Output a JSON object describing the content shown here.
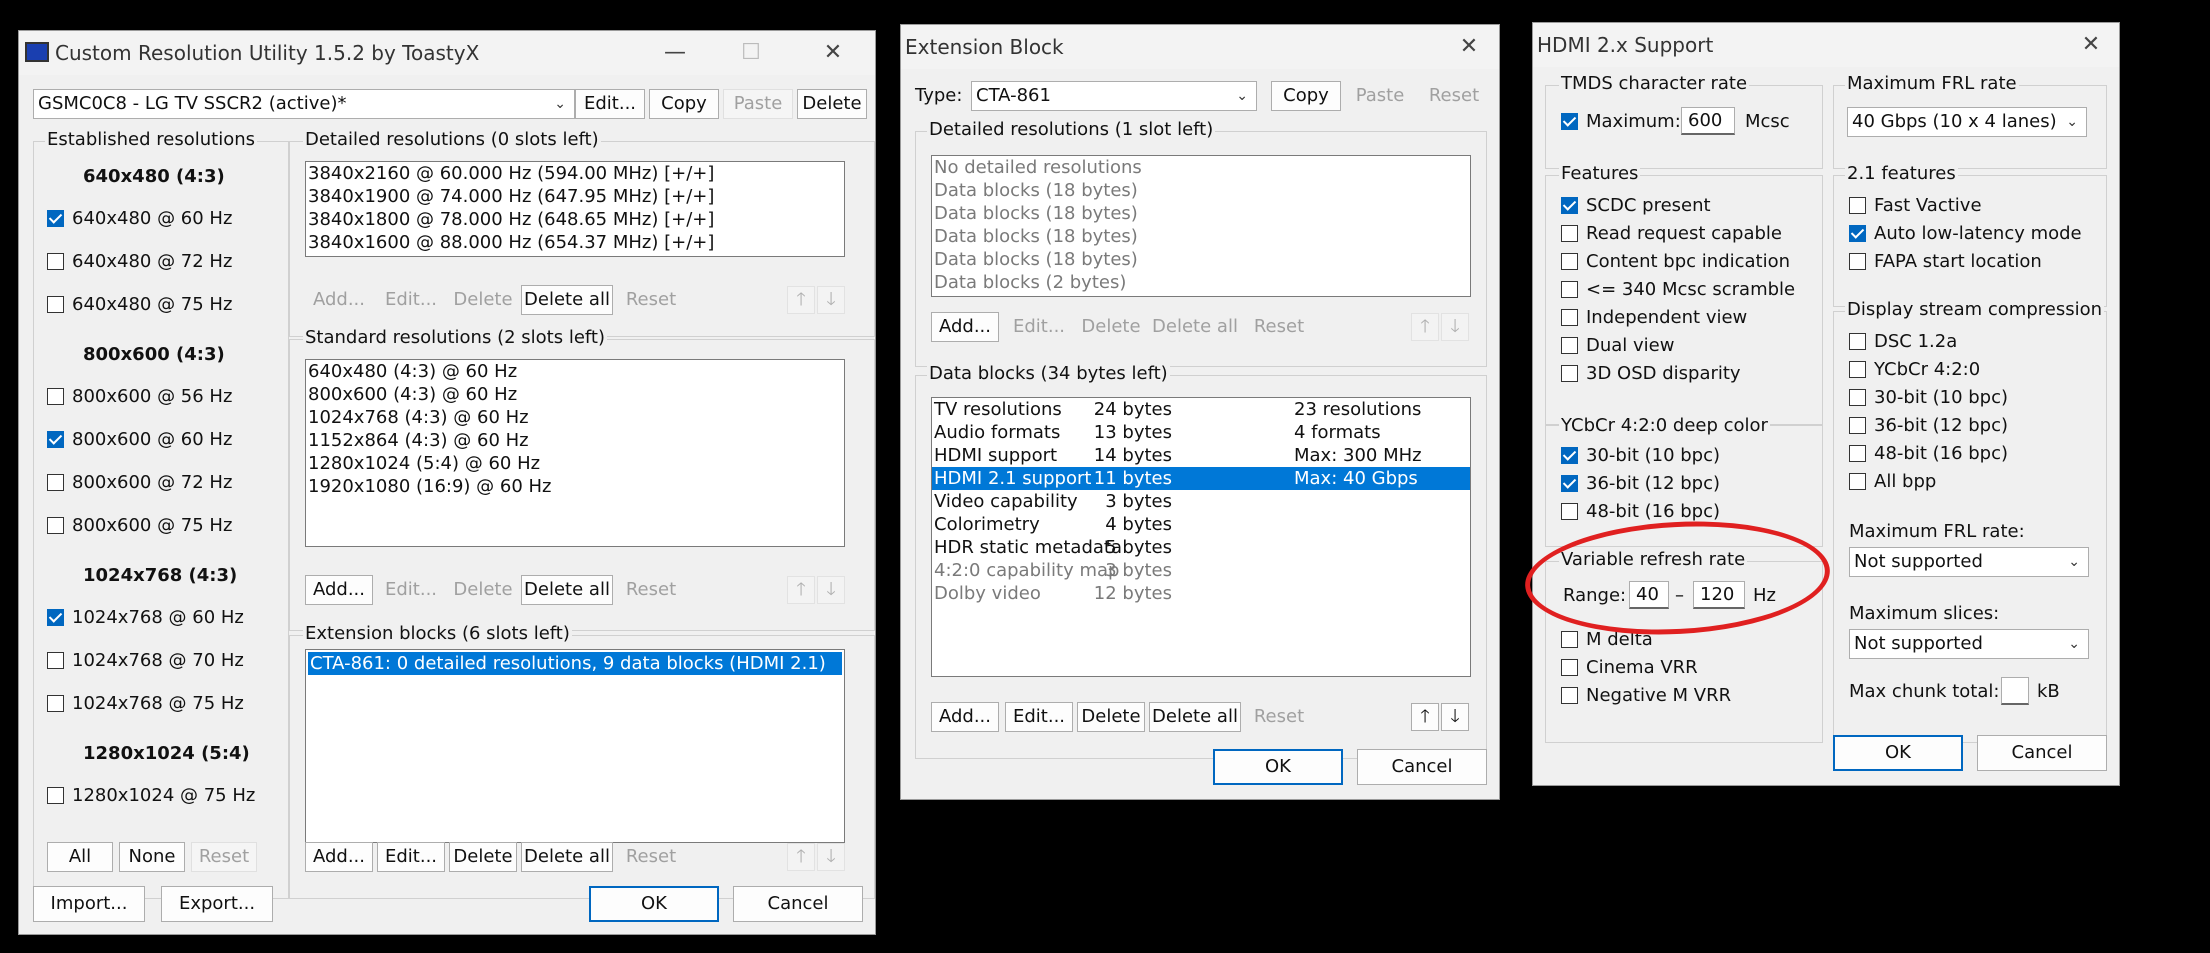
{
  "cru": {
    "title": "Custom Resolution Utility 1.5.2 by ToastyX",
    "monitor": "GSMC0C8 - LG TV SSCR2 (active)*",
    "top_buttons": [
      "Edit...",
      "Copy",
      "Paste",
      "Delete"
    ],
    "established": {
      "label": "Established resolutions",
      "groups": [
        {
          "head": "640x480 (4:3)",
          "items": [
            {
              "label": "640x480 @ 60 Hz",
              "checked": true
            },
            {
              "label": "640x480 @ 72 Hz",
              "checked": false
            },
            {
              "label": "640x480 @ 75 Hz",
              "checked": false
            }
          ]
        },
        {
          "head": "800x600 (4:3)",
          "items": [
            {
              "label": "800x600 @ 56 Hz",
              "checked": false
            },
            {
              "label": "800x600 @ 60 Hz",
              "checked": true
            },
            {
              "label": "800x600 @ 72 Hz",
              "checked": false
            },
            {
              "label": "800x600 @ 75 Hz",
              "checked": false
            }
          ]
        },
        {
          "head": "1024x768 (4:3)",
          "items": [
            {
              "label": "1024x768 @ 60 Hz",
              "checked": true
            },
            {
              "label": "1024x768 @ 70 Hz",
              "checked": false
            },
            {
              "label": "1024x768 @ 75 Hz",
              "checked": false
            }
          ]
        },
        {
          "head": "1280x1024 (5:4)",
          "items": [
            {
              "label": "1280x1024 @ 75 Hz",
              "checked": false
            }
          ]
        }
      ],
      "buttons": [
        "All",
        "None",
        "Reset"
      ]
    },
    "detailed": {
      "label": "Detailed resolutions (0 slots left)",
      "items": [
        "3840x2160 @ 60.000 Hz (594.00 MHz) [+/+]",
        "3840x1900 @ 74.000 Hz (647.95 MHz) [+/+]",
        "3840x1800 @ 78.000 Hz (648.65 MHz) [+/+]",
        "3840x1600 @ 88.000 Hz (654.37 MHz) [+/+]"
      ]
    },
    "standard": {
      "label": "Standard resolutions (2 slots left)",
      "items": [
        "640x480 (4:3) @ 60 Hz",
        "800x600 (4:3) @ 60 Hz",
        "1024x768 (4:3) @ 60 Hz",
        "1152x864 (4:3) @ 60 Hz",
        "1280x1024 (5:4) @ 60 Hz",
        "1920x1080 (16:9) @ 60 Hz"
      ]
    },
    "extension": {
      "label": "Extension blocks (6 slots left)",
      "items": [
        "CTA-861: 0 detailed resolutions, 9 data blocks (HDMI 2.1)"
      ]
    },
    "list_buttons": [
      "Add...",
      "Edit...",
      "Delete",
      "Delete all",
      "Reset"
    ],
    "import": "Import...",
    "export": "Export...",
    "ok": "OK",
    "cancel": "Cancel"
  },
  "ext": {
    "title": "Extension Block",
    "type_label": "Type:",
    "type_value": "CTA-861",
    "top_buttons": [
      "Copy",
      "Paste",
      "Reset"
    ],
    "detailed": {
      "label": "Detailed resolutions (1 slot left)",
      "items": [
        "No detailed resolutions",
        "Data blocks (18 bytes)",
        "Data blocks (18 bytes)",
        "Data blocks (18 bytes)",
        "Data blocks (18 bytes)",
        "Data blocks (2 bytes)"
      ]
    },
    "datablocks": {
      "label": "Data blocks (34 bytes left)",
      "rows": [
        {
          "name": "TV resolutions",
          "size": "24 bytes",
          "info": "23 resolutions"
        },
        {
          "name": "Audio formats",
          "size": "13 bytes",
          "info": "4 formats"
        },
        {
          "name": "HDMI support",
          "size": "14 bytes",
          "info": "Max: 300 MHz"
        },
        {
          "name": "HDMI 2.1 support",
          "size": "11 bytes",
          "info": "Max: 40 Gbps"
        },
        {
          "name": "Video capability",
          "size": "3 bytes",
          "info": ""
        },
        {
          "name": "Colorimetry",
          "size": "4 bytes",
          "info": ""
        },
        {
          "name": "HDR static metadata",
          "size": "5 bytes",
          "info": ""
        },
        {
          "name": "4:2:0 capability map",
          "size": "3 bytes",
          "info": ""
        },
        {
          "name": "Dolby video",
          "size": "12 bytes",
          "info": ""
        }
      ]
    },
    "list_buttons": [
      "Add...",
      "Edit...",
      "Delete",
      "Delete all",
      "Reset"
    ],
    "ok": "OK",
    "cancel": "Cancel"
  },
  "hdmi": {
    "title": "HDMI 2.x Support",
    "tmds": {
      "label": "TMDS character rate",
      "max_label": "Maximum:",
      "value": "600",
      "unit": "Mcsc"
    },
    "features": {
      "label": "Features",
      "items": [
        {
          "label": "SCDC present",
          "checked": true
        },
        {
          "label": "Read request capable",
          "checked": false
        },
        {
          "label": "Content bpc indication",
          "checked": false
        },
        {
          "label": "<= 340 Mcsc scramble",
          "checked": false
        },
        {
          "label": "Independent view",
          "checked": false
        },
        {
          "label": "Dual view",
          "checked": false
        },
        {
          "label": "3D OSD disparity",
          "checked": false
        }
      ]
    },
    "deepcolor": {
      "label": "YCbCr 4:2:0 deep color",
      "items": [
        {
          "label": "30-bit (10 bpc)",
          "checked": true
        },
        {
          "label": "36-bit (12 bpc)",
          "checked": true
        },
        {
          "label": "48-bit (16 bpc)",
          "checked": false
        }
      ]
    },
    "vrr": {
      "label": "Variable refresh rate",
      "range_label": "Range:",
      "min": "40",
      "dash": "–",
      "max": "120",
      "unit": "Hz",
      "items": [
        {
          "label": "M delta",
          "checked": false
        },
        {
          "label": "Cinema VRR",
          "checked": false
        },
        {
          "label": "Negative M VRR",
          "checked": false
        }
      ]
    },
    "frl": {
      "label": "Maximum FRL rate",
      "value": "40 Gbps (10 x 4 lanes)"
    },
    "features21": {
      "label": "2.1 features",
      "items": [
        {
          "label": "Fast Vactive",
          "checked": false
        },
        {
          "label": "Auto low-latency mode",
          "checked": true
        },
        {
          "label": "FAPA start location",
          "checked": false
        }
      ]
    },
    "dsc": {
      "label": "Display stream compression",
      "items": [
        {
          "label": "DSC 1.2a",
          "checked": false
        },
        {
          "label": "YCbCr 4:2:0",
          "checked": false
        },
        {
          "label": "30-bit (10 bpc)",
          "checked": false
        },
        {
          "label": "36-bit (12 bpc)",
          "checked": false
        },
        {
          "label": "48-bit (16 bpc)",
          "checked": false
        },
        {
          "label": "All bpp",
          "checked": false
        }
      ],
      "frl_label": "Maximum FRL rate:",
      "frl_value": "Not supported",
      "slices_label": "Maximum slices:",
      "slices_value": "Not supported",
      "chunk_label": "Max chunk total:",
      "chunk_unit": "kB"
    },
    "ok": "OK",
    "cancel": "Cancel"
  }
}
